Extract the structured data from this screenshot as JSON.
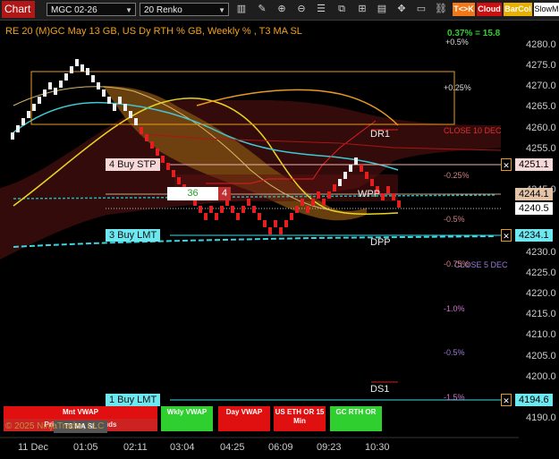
{
  "toolbar": {
    "chart_tab": "Chart",
    "instrument": "MGC 02-26",
    "bar_type": "20 Renko",
    "btn_tk": "T<>K",
    "btn_cloud": "Cloud",
    "btn_barcol": "BarCol",
    "btn_slow": "SlowM"
  },
  "header": {
    "label": "RE 20  (M)GC May 13 GB, US Dy RTH % GB, Weekly % , T3 MA SL",
    "perf": "0.37% = 15.8"
  },
  "axis": {
    "prices": [
      "4280.0",
      "4275.0",
      "4270.0",
      "4265.0",
      "4260.0",
      "4255.0",
      "4250.0",
      "4245.0",
      "4240.0",
      "4235.0",
      "4230.0",
      "4225.0",
      "4220.0",
      "4215.0",
      "4210.0",
      "4205.0",
      "4200.0",
      "4195.0",
      "4190.0"
    ],
    "tags": {
      "stp": "4251.1",
      "wpp": "4244.1",
      "last": "4240.5",
      "lmt3": "4234.1",
      "lmt1": "4194.6"
    }
  },
  "times": [
    "11 Dec",
    "01:05",
    "02:11",
    "03:04",
    "04:25",
    "06:09",
    "09:23",
    "10:30"
  ],
  "orders": {
    "stp": "4  Buy STP",
    "lmt3": "3  Buy LMT",
    "lmt1": "1  Buy LMT",
    "qty": "36",
    "qty_side": "4"
  },
  "levels": {
    "dr1": "DR1",
    "wpp": "WPP",
    "dpp": "DPP",
    "ds1": "DS1",
    "close": "CLOSE 10 DEC",
    "close2": "CLOSE 5 DEC"
  },
  "percents": {
    "p05_top": "+0.5%",
    "p025": "+0.25%",
    "m025": "-0.25%",
    "m05": "-0.5%",
    "m075": "-0.75%",
    "m10": "-1.0%",
    "m05b": "-0.5%",
    "m15": "-1.5%"
  },
  "vwap": {
    "mnt": "Mnt VWAP",
    "price_outside": "Price Outside Clouds",
    "t3ma": "T3 MA SL",
    "wkly": "Wkly VWAP",
    "day": "Day VWAP",
    "useth": "US ETH OR 15 Min",
    "gcrth": "GC RTH OR"
  },
  "copyright": "© 2025 NinjaTrader, LLC"
}
